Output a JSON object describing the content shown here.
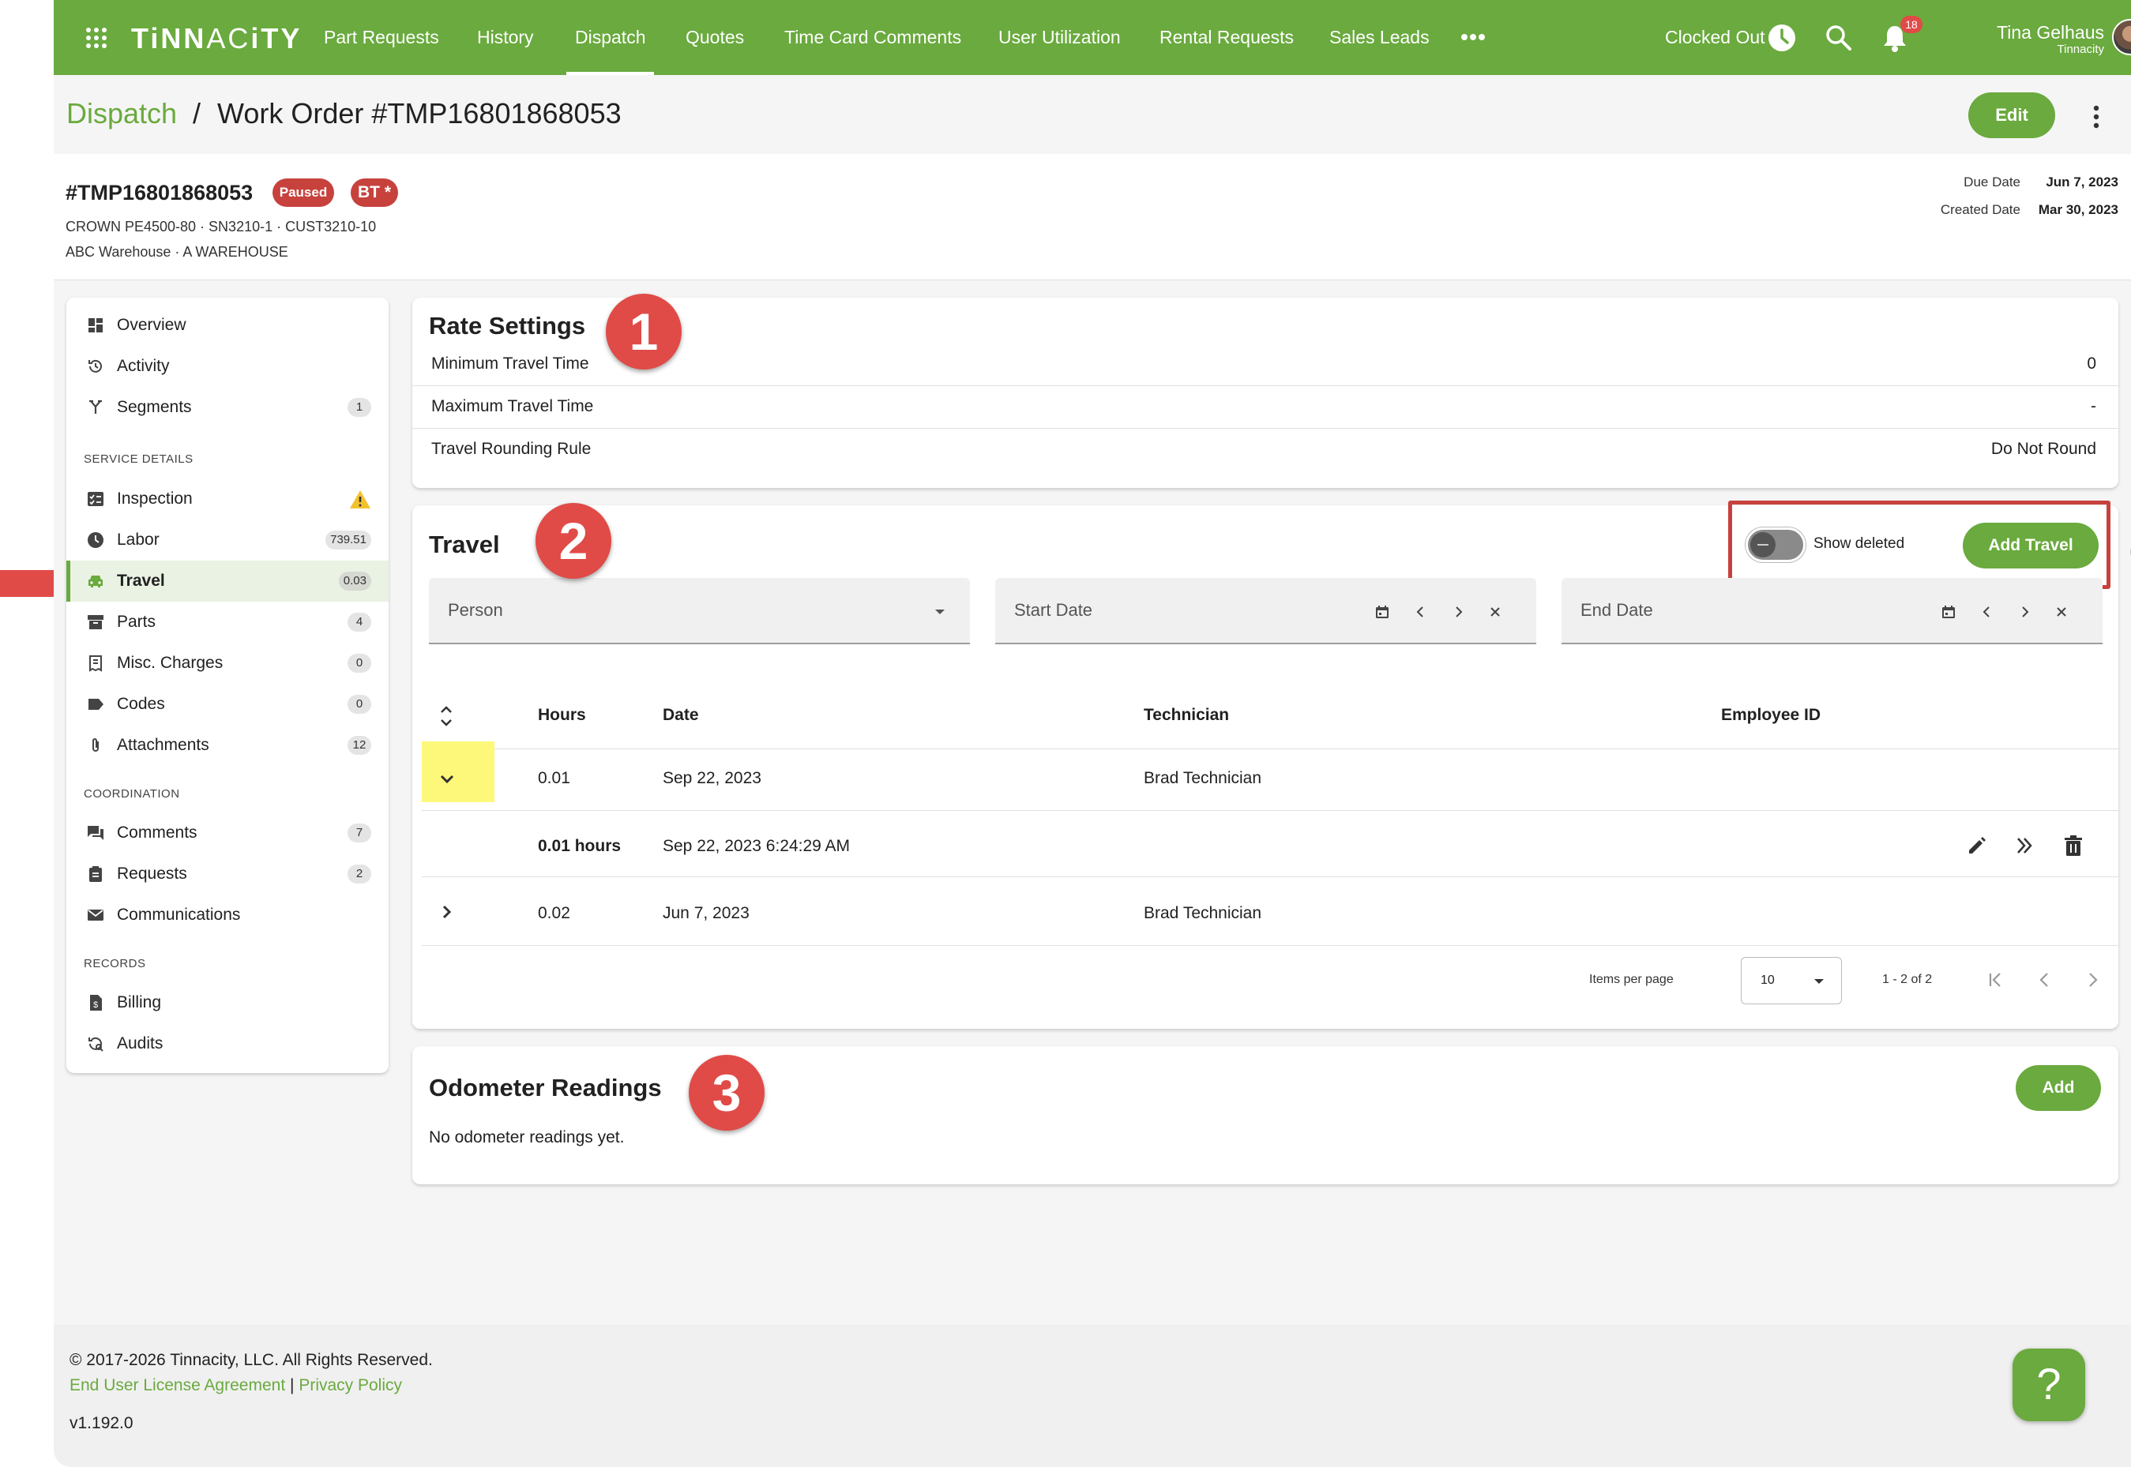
{
  "brand": {
    "logo_bold": "TiNN",
    "logo_light": "AC",
    "logo_bold2": "iTY"
  },
  "nav": {
    "items": [
      "Part Requests",
      "History",
      "Dispatch",
      "Quotes",
      "Time Card Comments",
      "User Utilization",
      "Rental Requests",
      "Sales Leads"
    ],
    "active": "Dispatch"
  },
  "user": {
    "clock_status": "Clocked Out",
    "notifications": "18",
    "name": "Tina Gelhaus",
    "org": "Tinnacity"
  },
  "breadcrumb": {
    "root": "Dispatch",
    "sep": "/",
    "current": "Work Order #TMP16801868053"
  },
  "header": {
    "edit_label": "Edit",
    "wo_number": "#TMP16801868053",
    "status_badge": "Paused",
    "tech_badge": "BT *",
    "equipment": "CROWN PE4500-80 · SN3210-1 · CUST3210-10",
    "location": "ABC Warehouse · A WAREHOUSE",
    "due_label": "Due Date",
    "due_value": "Jun 7, 2023",
    "created_label": "Created Date",
    "created_value": "Mar 30, 2023"
  },
  "sidebar": {
    "items": [
      {
        "label": "Overview"
      },
      {
        "label": "Activity"
      },
      {
        "label": "Segments",
        "count": "1"
      }
    ],
    "service_title": "SERVICE DETAILS",
    "service": [
      {
        "label": "Inspection"
      },
      {
        "label": "Labor",
        "count": "739.51"
      },
      {
        "label": "Travel",
        "count": "0.03"
      },
      {
        "label": "Parts",
        "count": "4"
      },
      {
        "label": "Misc. Charges",
        "count": "0"
      },
      {
        "label": "Codes",
        "count": "0"
      },
      {
        "label": "Attachments",
        "count": "12"
      }
    ],
    "coord_title": "COORDINATION",
    "coord": [
      {
        "label": "Comments",
        "count": "7"
      },
      {
        "label": "Requests",
        "count": "2"
      },
      {
        "label": "Communications"
      }
    ],
    "records_title": "RECORDS",
    "records": [
      {
        "label": "Billing"
      },
      {
        "label": "Audits"
      }
    ]
  },
  "rate": {
    "title": "Rate Settings",
    "rows": [
      {
        "label": "Minimum Travel Time",
        "value": "0"
      },
      {
        "label": "Maximum Travel Time",
        "value": "-"
      },
      {
        "label": "Travel Rounding Rule",
        "value": "Do Not Round"
      }
    ]
  },
  "travel": {
    "title": "Travel",
    "show_deleted": "Show deleted",
    "add_label": "Add Travel",
    "filters": {
      "person": "Person",
      "start": "Start Date",
      "end": "End Date"
    },
    "columns": [
      "Hours",
      "Date",
      "Technician",
      "Employee ID"
    ],
    "rows": [
      {
        "hours": "0.01",
        "date": "Sep 22, 2023",
        "tech": "Brad Technician"
      },
      {
        "hours": "0.02",
        "date": "Jun 7, 2023",
        "tech": "Brad Technician"
      }
    ],
    "detail": {
      "hours": "0.01 hours",
      "datetime": "Sep 22, 2023 6:24:29 AM"
    },
    "pager": {
      "label": "Items per page",
      "size": "10",
      "range": "1 - 2 of 2"
    }
  },
  "odometer": {
    "title": "Odometer Readings",
    "add_label": "Add",
    "empty": "No odometer readings yet."
  },
  "markers": [
    "1",
    "2",
    "3"
  ],
  "footer": {
    "copyright": "© 2017-2026 Tinnacity, LLC. All Rights Reserved.",
    "eula": "End User License Agreement",
    "sep": "|",
    "privacy": "Privacy Policy",
    "version": "v1.192.0",
    "help": "?"
  },
  "colors": {
    "brand_green": "#6aaa3e",
    "marker_red": "#e04b47",
    "badge_red": "#c7413d",
    "highlight_yellow": "#fdf87a"
  }
}
